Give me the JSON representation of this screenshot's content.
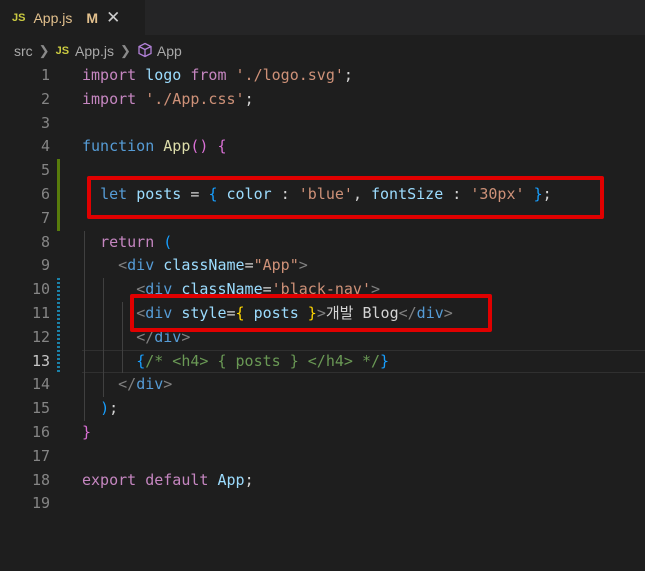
{
  "tab": {
    "icon": "JS",
    "title": "App.js",
    "status": "M",
    "close": "✕"
  },
  "breadcrumb": {
    "folder": "src",
    "file_icon": "JS",
    "file": "App.js",
    "symbol": "App",
    "symbol_icon": "cube-icon"
  },
  "editor": {
    "active_line": 13,
    "line_numbers": [
      "1",
      "2",
      "3",
      "4",
      "5",
      "6",
      "7",
      "8",
      "9",
      "10",
      "11",
      "12",
      "13",
      "14",
      "15",
      "16",
      "17",
      "18",
      "19"
    ]
  },
  "colors": {
    "highlight": "#e00000",
    "modified_gutter": "#587c0c",
    "changed_gutter": "#1b81a8"
  }
}
